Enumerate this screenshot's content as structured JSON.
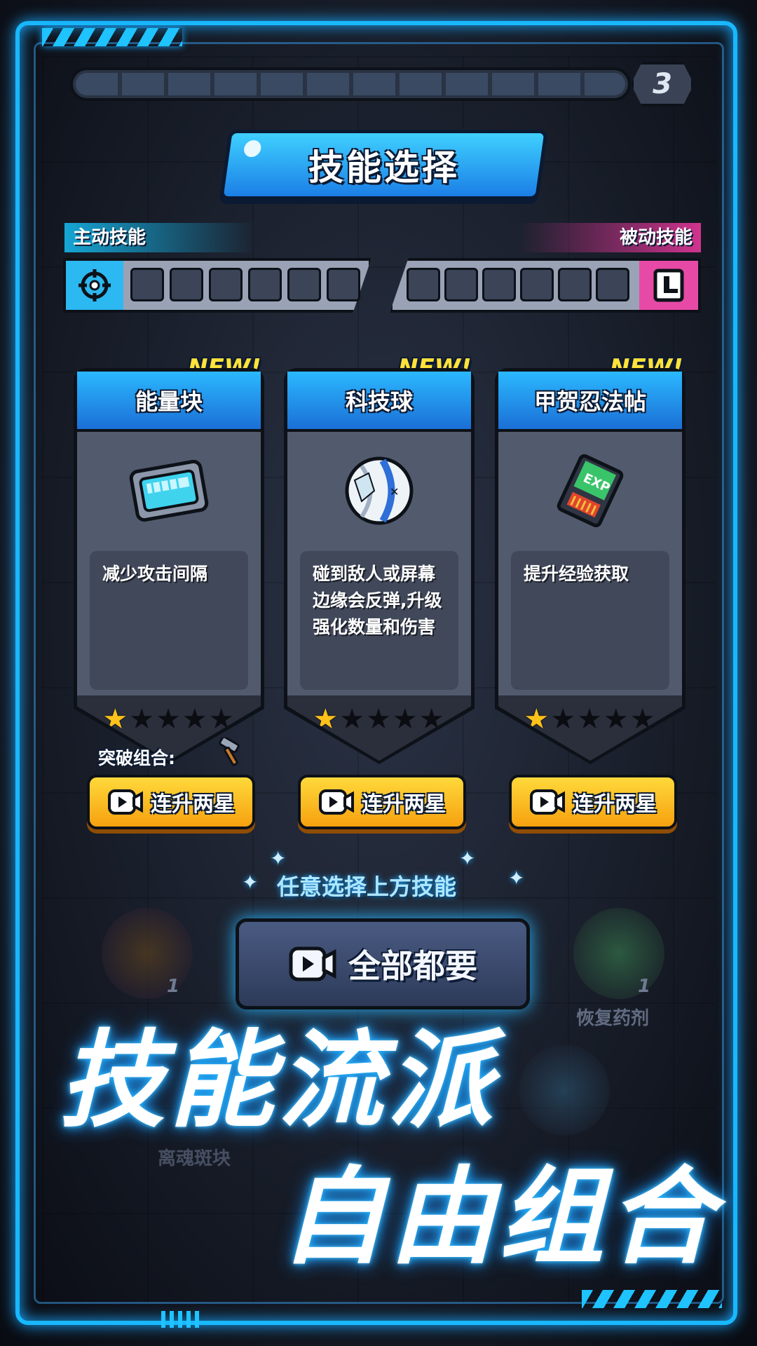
{
  "header": {
    "level": "3",
    "title": "技能选择"
  },
  "skill_bar": {
    "active_label": "主动技能",
    "passive_label": "被动技能",
    "active_slot_count": 6,
    "passive_slot_count": 6,
    "active_icon": "crosshair-icon",
    "passive_icon": "device-icon"
  },
  "cards": [
    {
      "tag": "NEW!",
      "name": "能量块",
      "icon": "energy-block-icon",
      "description": "减少攻击间隔",
      "stars_filled": 1,
      "stars_total": 5
    },
    {
      "tag": "NEW!",
      "name": "科技球",
      "icon": "tech-ball-icon",
      "description": "碰到敌人或屏幕边缘会反弹,升级强化数量和伤害",
      "stars_filled": 1,
      "stars_total": 5
    },
    {
      "tag": "NEW!",
      "name": "甲贺忍法帖",
      "icon": "exp-card-icon",
      "description": "提升经验获取",
      "stars_filled": 1,
      "stars_total": 5
    }
  ],
  "breakthrough_label": "突破组合:",
  "upgrade_button_label": "连升两星",
  "choose_hint": "任意选择上方技能",
  "all_button_label": "全部都要",
  "background": {
    "recover_label": "恢复药剂",
    "blurred_label": "离魂斑块",
    "left_count": "1",
    "right_count": "1"
  },
  "slogan": {
    "line1": "技能流派",
    "line2": "自由组合"
  },
  "colors": {
    "neon": "#18b8ff",
    "card_head": "#2bb8ff",
    "button_yellow": "#ffd93a",
    "star": "#ffc21a",
    "passive_pink": "#e74aa6"
  }
}
